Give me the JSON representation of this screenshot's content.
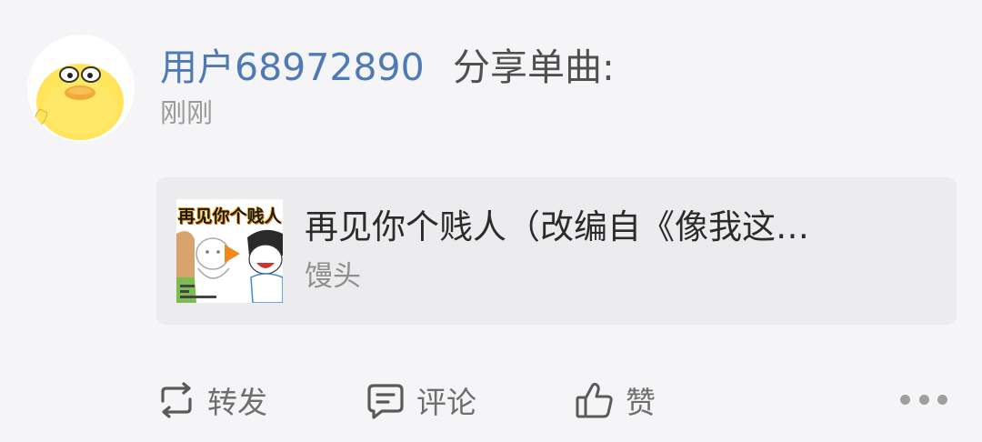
{
  "post": {
    "username": "用户68972890",
    "share_label": "分享单曲:",
    "timestamp": "刚刚"
  },
  "music_card": {
    "cover_title": "再见你个贱人",
    "song_title": "再见你个贱人（改编自《像我这…",
    "artist": "馒头"
  },
  "actions": {
    "repost_label": "转发",
    "comment_label": "评论",
    "like_label": "赞"
  },
  "icons": {
    "avatar": "yellow-duck-avatar",
    "repost": "repost-icon",
    "comment": "comment-icon",
    "like": "thumbs-up-icon",
    "more": "more-dots-icon"
  },
  "colors": {
    "username": "#4f7ab3",
    "background": "#f5f5f7",
    "card": "#ececee"
  }
}
